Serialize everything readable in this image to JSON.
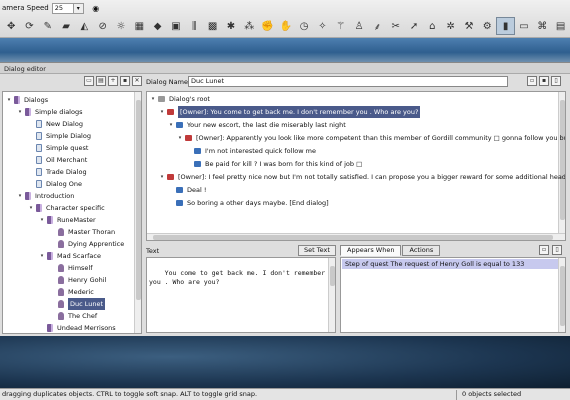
{
  "toolbar": {
    "camera_speed_label": "amera Speed",
    "camera_speed_value": "25",
    "icons": [
      "move-icon",
      "rotate-icon",
      "brush-icon",
      "paint-icon",
      "sculpt-icon",
      "no-entry-icon",
      "sun-icon",
      "grid-icon",
      "cube-icon",
      "layers-icon",
      "equalizer-icon",
      "terrain-icon",
      "snowflake-icon",
      "effects-icon",
      "fist-icon",
      "hand-icon",
      "clock-icon",
      "sparkle-icon",
      "wand-icon",
      "stick-figure-icon",
      "tree-icon",
      "scissors-icon",
      "arrow-icon",
      "hat-icon",
      "bug-icon",
      "wrench-icon",
      "gear-icon",
      "speech-bubble-icon",
      "chat-icon",
      "lamp-icon",
      "panel-icon"
    ]
  },
  "editor": {
    "title": "Dialog editor",
    "dialog_name_label": "Dialog Name:",
    "dialog_name_value": "Duc Lunet",
    "text_label": "Text",
    "set_text_button": "Set Text",
    "text_value": "You come to get back me. I don't remember you . Who are you?",
    "tabs": [
      "Appears When",
      "Actions"
    ],
    "condition": "Step of quest The request of Henry Goll is equal to 133"
  },
  "tree": [
    {
      "label": "Dialogs",
      "indent": 0,
      "icon": "book",
      "open": true
    },
    {
      "label": "Simple dialogs",
      "indent": 1,
      "icon": "book",
      "open": true
    },
    {
      "label": "New Dialog",
      "indent": 2,
      "icon": "page"
    },
    {
      "label": "Simple Dialog",
      "indent": 2,
      "icon": "page"
    },
    {
      "label": "Simple quest",
      "indent": 2,
      "icon": "page"
    },
    {
      "label": "Oil Merchant",
      "indent": 2,
      "icon": "page"
    },
    {
      "label": "Trade Dialog",
      "indent": 2,
      "icon": "page"
    },
    {
      "label": "Dialog One",
      "indent": 2,
      "icon": "page"
    },
    {
      "label": "Introduction",
      "indent": 1,
      "icon": "book",
      "open": true
    },
    {
      "label": "Character specific",
      "indent": 2,
      "icon": "book",
      "open": true
    },
    {
      "label": "RuneMaster",
      "indent": 3,
      "icon": "book",
      "open": true
    },
    {
      "label": "Master Thoran",
      "indent": 4,
      "icon": "person"
    },
    {
      "label": "Dying Apprentice",
      "indent": 4,
      "icon": "person"
    },
    {
      "label": "Mad Scarface",
      "indent": 3,
      "icon": "book",
      "open": true
    },
    {
      "label": "Himself",
      "indent": 4,
      "icon": "person"
    },
    {
      "label": "Henry Gohil",
      "indent": 4,
      "icon": "person"
    },
    {
      "label": "Mederic",
      "indent": 4,
      "icon": "person"
    },
    {
      "label": "Duc Lunet",
      "indent": 4,
      "icon": "person",
      "selected": true
    },
    {
      "label": "The Chef",
      "indent": 4,
      "icon": "person"
    },
    {
      "label": "Undead Merrisons",
      "indent": 3,
      "icon": "book"
    }
  ],
  "graph": [
    {
      "label": "Dialog's root",
      "indent": 0,
      "bubble": "gray",
      "open": true
    },
    {
      "label": "[Owner]: You come to get back me. I don't remember you . Who are you?",
      "indent": 1,
      "bubble": "red",
      "open": true,
      "selected": true
    },
    {
      "label": "Your new escort, the last die miserably last night",
      "indent": 2,
      "bubble": "blue",
      "open": true
    },
    {
      "label": "[Owner]: Apparently you look like more competent than this member of Gordill community □ gonna follow you but if you have the tim",
      "indent": 3,
      "bubble": "red",
      "open": true
    },
    {
      "label": "I'm not interested quick follow me",
      "indent": 4,
      "bubble": "blue"
    },
    {
      "label": "Be paid for kill ? I was born for this kind of job □",
      "indent": 4,
      "bubble": "blue"
    },
    {
      "label": "[Owner]: I feel pretty nice now but I'm not totally satisfied. I can propose you a bigger reward for some additional head.",
      "indent": 1,
      "bubble": "red",
      "open": true
    },
    {
      "label": "Deal !",
      "indent": 2,
      "bubble": "blue"
    },
    {
      "label": "So boring a other days maybe. [End dialog]",
      "indent": 2,
      "bubble": "blue"
    }
  ],
  "status": {
    "left": "dragging duplicates objects.  CTRL to toggle soft snap.  ALT to toggle grid snap.",
    "right": "0 objects selected"
  }
}
